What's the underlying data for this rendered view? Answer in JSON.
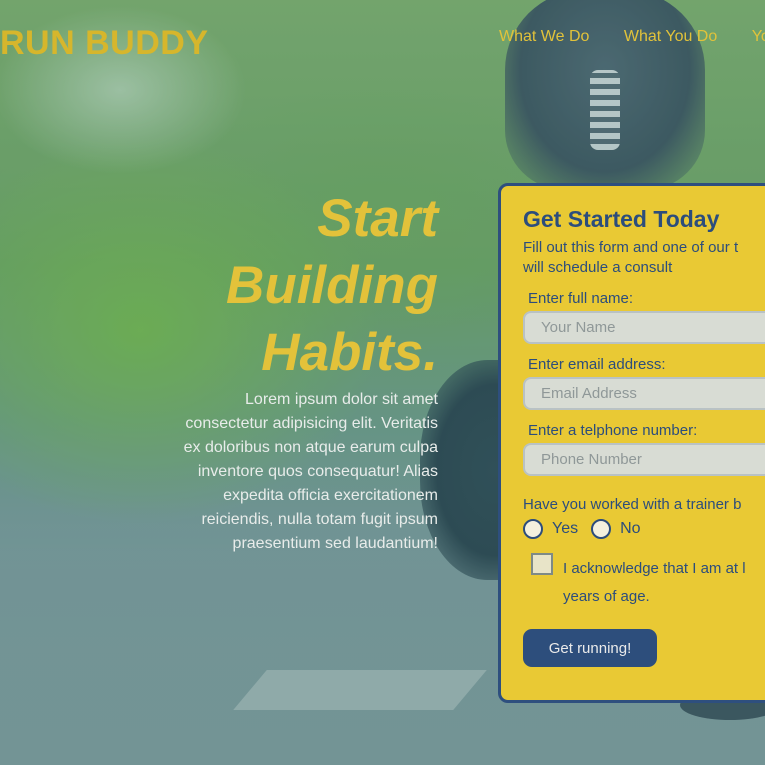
{
  "header": {
    "brand": "RUN BUDDY",
    "nav": [
      "What We Do",
      "What You Do",
      "Yo"
    ]
  },
  "hero": {
    "headline_lines": [
      "Start",
      "Building",
      "Habits."
    ],
    "paragraph_lines": [
      "Lorem ipsum dolor sit amet",
      "consectetur adipisicing elit. Veritatis",
      "ex doloribus non atque earum culpa",
      "inventore quos consequatur! Alias",
      "expedita officia exercitationem",
      "reiciendis, nulla totam fugit ipsum",
      "praesentium sed laudantium!"
    ]
  },
  "form": {
    "title": "Get Started Today",
    "intro_line1": "Fill out this form and one of our t",
    "intro_line2": "will schedule a consult",
    "name_label": "Enter full name:",
    "name_placeholder": "Your Name",
    "email_label": "Enter email address:",
    "email_placeholder": "Email Address",
    "phone_label": "Enter a telphone number:",
    "phone_placeholder": "Phone Number",
    "trainer_question": "Have you worked with a trainer b",
    "option_yes": "Yes",
    "option_no": "No",
    "ack_line1": "I acknowledge that I am at l",
    "ack_line2": "years of age.",
    "submit_label": "Get running!"
  },
  "colors": {
    "accent_yellow": "#e9c934",
    "navy": "#2d4e7c"
  }
}
